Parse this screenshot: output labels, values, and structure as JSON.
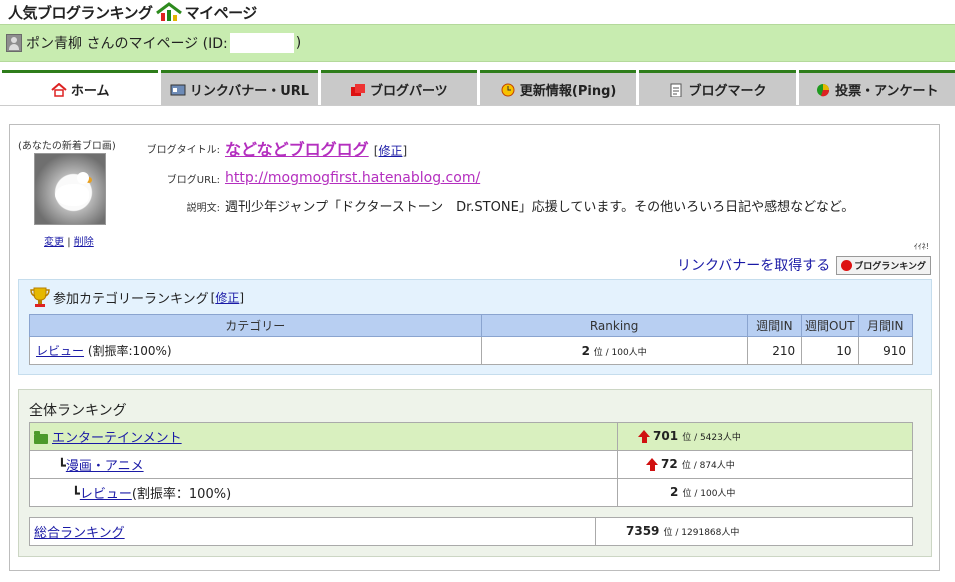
{
  "site": {
    "title": "人気ブログランキング",
    "subtitle": "マイページ"
  },
  "user": {
    "prefix": "ポン青柳 さんのマイページ (ID:",
    "suffix": ")"
  },
  "tabs": [
    {
      "label": "ホーム",
      "icon": "home-icon"
    },
    {
      "label": "リンクバナー・URL",
      "icon": "banner-icon"
    },
    {
      "label": "ブログパーツ",
      "icon": "blocks-icon"
    },
    {
      "label": "更新情報(Ping)",
      "icon": "clock-icon"
    },
    {
      "label": "ブログマーク",
      "icon": "clipboard-icon"
    },
    {
      "label": "投票・アンケート",
      "icon": "pie-chart-icon"
    }
  ],
  "blog": {
    "thumb_caption": "(あなたの新着ブロ画)",
    "change_label": "変更",
    "delete_label": "削除",
    "title_label": "ブログタイトル:",
    "title": "などなどブログログ",
    "edit_label": "修正",
    "url_label": "ブログURL:",
    "url": "http://mogmogfirst.hatenablog.com/",
    "desc_label": "説明文:",
    "desc": "週刊少年ジャンプ「ドクターストーン　Dr.STONE」応援しています。その他いろいろ日記や感想などなど。",
    "iine": "ｲｲﾈ!",
    "banner_link": "リンクバナーを取得する",
    "banner_badge": "ブログランキング"
  },
  "category_ranking": {
    "heading": "参加カテゴリーランキング",
    "edit_label": "修正",
    "headers": [
      "カテゴリー",
      "Ranking",
      "週間IN",
      "週間OUT",
      "月間IN"
    ],
    "rows": [
      {
        "category": "レビュー",
        "share": " (割振率:100%)",
        "rank": "2",
        "rank_unit": "位 / 100人中",
        "week_in": "210",
        "week_out": "10",
        "month_in": "910"
      }
    ]
  },
  "overall_ranking": {
    "heading": "全体ランキング",
    "rows": [
      {
        "name": "エンターテインメント",
        "extra": "",
        "rank": "701",
        "rank_unit": "位 / 5423人中",
        "up": true
      },
      {
        "name": "漫画・アニメ",
        "extra": "",
        "rank": "72",
        "rank_unit": "位 / 874人中",
        "up": true
      },
      {
        "name": "レビュー",
        "extra": "(割振率：100%)",
        "rank": "2",
        "rank_unit": "位 / 100人中",
        "up": false
      }
    ],
    "total": {
      "name": "総合ランキング",
      "rank": "7359",
      "rank_unit": "位 / 1291868人中"
    }
  }
}
